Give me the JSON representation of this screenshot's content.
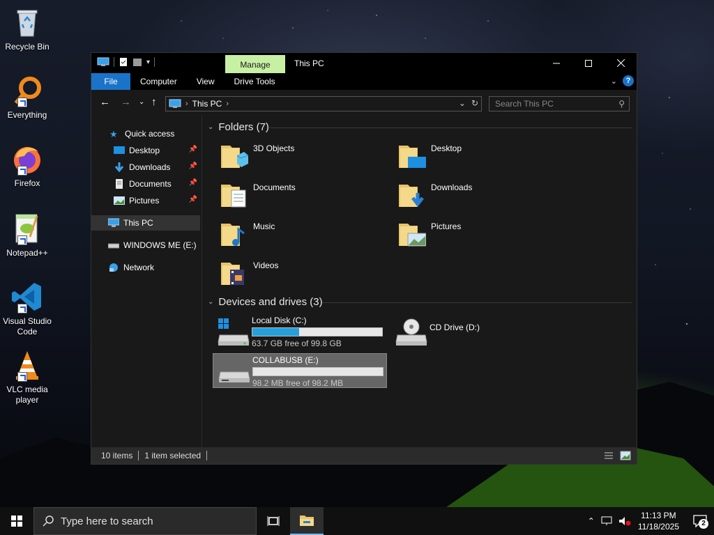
{
  "desktop": {
    "icons": [
      {
        "label": "Recycle Bin"
      },
      {
        "label": "Everything"
      },
      {
        "label": "Firefox"
      },
      {
        "label": "Notepad++"
      },
      {
        "label": "Visual Studio Code"
      },
      {
        "label": "VLC media player"
      }
    ]
  },
  "window": {
    "title": "This PC",
    "manage_tab": "Manage",
    "ribbon_tabs": {
      "file": "File",
      "computer": "Computer",
      "view": "View",
      "drive_tools": "Drive Tools"
    },
    "help": "?",
    "address": {
      "crumb": "This PC"
    },
    "search_placeholder": "Search This PC",
    "nav": {
      "quick_access": "Quick access",
      "desktop": "Desktop",
      "downloads": "Downloads",
      "documents": "Documents",
      "pictures": "Pictures",
      "this_pc": "This PC",
      "windows_me": "WINDOWS ME (E:)",
      "network": "Network"
    },
    "folders_header": "Folders (7)",
    "folders": [
      {
        "label": "3D Objects"
      },
      {
        "label": "Desktop"
      },
      {
        "label": "Documents"
      },
      {
        "label": "Downloads"
      },
      {
        "label": "Music"
      },
      {
        "label": "Pictures"
      },
      {
        "label": "Videos"
      }
    ],
    "devices_header": "Devices and drives (3)",
    "drives": [
      {
        "name": "Local Disk (C:)",
        "free_text": "63.7 GB free of 99.8 GB",
        "used_fraction": 0.36
      },
      {
        "name": "CD Drive (D:)"
      },
      {
        "name": "COLLABUSB (E:)",
        "free_text": "98.2 MB free of 98.2 MB",
        "used_fraction": 0.0
      }
    ],
    "status": {
      "items": "10 items",
      "selected": "1 item selected"
    }
  },
  "taskbar": {
    "search_placeholder": "Type here to search",
    "time": "11:13 PM",
    "date": "11/18/2025",
    "notification_count": "2"
  },
  "colors": {
    "accent": "#1a73c8",
    "manage_tab": "#c8f0a4",
    "drive_fill": "#26a0da"
  }
}
